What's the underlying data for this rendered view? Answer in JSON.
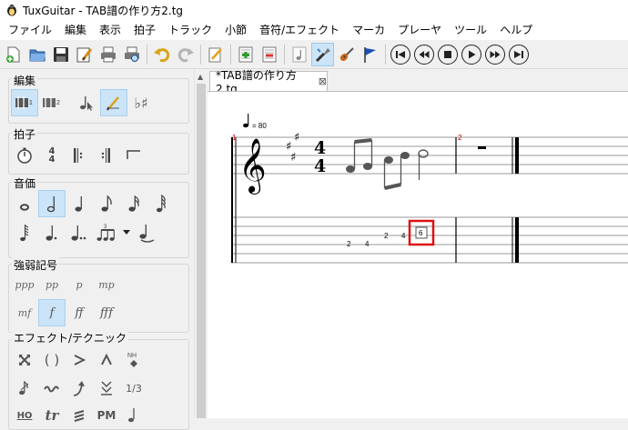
{
  "window": {
    "title": "TuxGuitar - TAB譜の作り方2.tg"
  },
  "menu": [
    "ファイル",
    "編集",
    "表示",
    "拍子",
    "トラック",
    "小節",
    "音符/エフェクト",
    "マーカ",
    "プレーヤ",
    "ツール",
    "ヘルプ"
  ],
  "toolbar": {
    "icons": [
      "new-file-icon",
      "open-file-icon",
      "save-icon",
      "properties-icon",
      "print-icon",
      "print-preview-icon",
      "undo-icon",
      "redo-icon",
      "edit-icon",
      "add-track-icon",
      "remove-track-icon",
      "note-icon",
      "tuner-icon",
      "guitar-icon",
      "flag-icon"
    ],
    "player": [
      "first-icon",
      "previous-icon",
      "stop-icon",
      "play-icon",
      "next-icon",
      "last-icon"
    ]
  },
  "panel": {
    "groups": [
      {
        "title": "編集"
      },
      {
        "title": "拍子"
      },
      {
        "title": "音価"
      },
      {
        "title": "強弱記号"
      },
      {
        "title": "エフェクト/テクニック"
      }
    ],
    "dynamics_row1": [
      "ppp",
      "pp",
      "p",
      "mp"
    ],
    "dynamics_row2": [
      "mf",
      "f",
      "ff",
      "fff"
    ],
    "effects_text": [
      "NH",
      "1/3",
      "HO",
      "tr",
      "PM"
    ]
  },
  "tab": {
    "label": "*TAB譜の作り方2.tg",
    "close": "⊠"
  },
  "score": {
    "tempo": "= 80",
    "measure1": "1",
    "measure2": "2",
    "timesig_top": "4",
    "timesig_bottom": "4",
    "tab_numbers": [
      "2",
      "4",
      "2",
      "4",
      "6"
    ],
    "accent_color": "#cc0000",
    "selection_color": "#dd1111"
  }
}
